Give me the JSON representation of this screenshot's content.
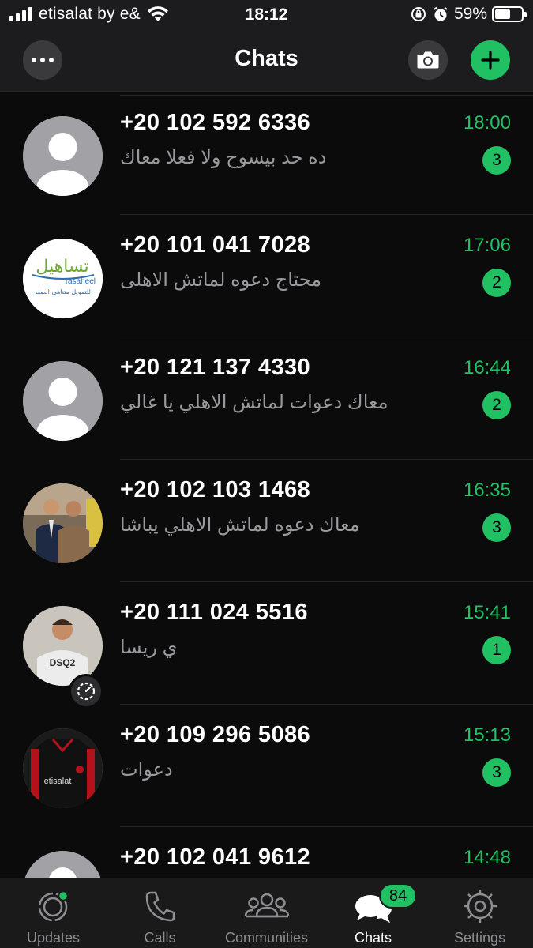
{
  "status_bar": {
    "carrier": "etisalat by e&",
    "time": "18:12",
    "battery_percent": "59%",
    "battery_level": 0.59,
    "icons": [
      "signal-icon",
      "wifi-icon",
      "orientation-lock-icon",
      "alarm-icon",
      "battery-icon"
    ]
  },
  "header": {
    "title": "Chats",
    "more_icon": "more-dots-icon",
    "camera_icon": "camera-icon",
    "new_chat_icon": "plus-icon"
  },
  "chats": [
    {
      "name": "+20 102 592 6336",
      "message": "ده حد بيسوح ولا فعلا معاك",
      "time": "18:00",
      "unread": "3",
      "avatar": "default"
    },
    {
      "name": "+20 101 041 7028",
      "message": "محتاج دعوه لماتش الاهلى",
      "time": "17:06",
      "unread": "2",
      "avatar": "logo",
      "avatar_text": {
        "ar": "تساهيل",
        "en": "Tasaheel",
        "sub": "للتمويل متناهي الصغر"
      }
    },
    {
      "name": "+20 121 137 4330",
      "message": "معاك دعوات لماتش الاهلي يا غالي",
      "time": "16:44",
      "unread": "2",
      "avatar": "default"
    },
    {
      "name": "+20 102 103 1468",
      "message": "معاك دعوه لماتش الاهلي يباشا",
      "time": "16:35",
      "unread": "3",
      "avatar": "photo-two-men"
    },
    {
      "name": "+20 111 024 5516",
      "message": "ي ريسا",
      "time": "15:41",
      "unread": "1",
      "avatar": "photo-man",
      "avatar_photo_text": "DSQ2",
      "status_icon": "disappearing-timer-icon"
    },
    {
      "name": "+20 109 296 5086",
      "message": "دعوات",
      "time": "15:13",
      "unread": "3",
      "avatar": "photo-jersey",
      "avatar_photo_text": "etisalat"
    },
    {
      "name": "+20 102 041 9612",
      "message": "",
      "time": "14:48",
      "unread": "",
      "avatar": "default"
    }
  ],
  "tabs": [
    {
      "label": "Updates",
      "icon": "updates-icon",
      "active": false,
      "dot": true
    },
    {
      "label": "Calls",
      "icon": "phone-icon",
      "active": false
    },
    {
      "label": "Communities",
      "icon": "communities-icon",
      "active": false
    },
    {
      "label": "Chats",
      "icon": "chats-icon",
      "active": true,
      "badge": "84"
    },
    {
      "label": "Settings",
      "icon": "settings-gear-icon",
      "active": false
    }
  ],
  "colors": {
    "accent": "#21c063",
    "background": "#0b0b0b",
    "header": "#1c1c1e",
    "muted_text": "#9a9a9e"
  }
}
